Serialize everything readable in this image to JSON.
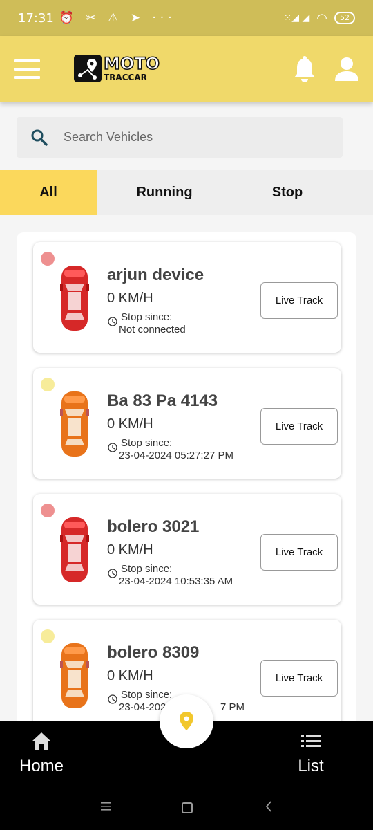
{
  "status_bar": {
    "time": "17:31",
    "icons": "⏰ ✂ ⚠ ➤ ···",
    "signal": "⁙◢ ◢",
    "battery": "52"
  },
  "app_bar": {
    "logo_title": "MOTO",
    "logo_subtitle": "TRACCAR",
    "accent_color": "#f0d96a"
  },
  "search": {
    "placeholder": "Search Vehicles"
  },
  "tabs": [
    {
      "label": "All",
      "active": true
    },
    {
      "label": "Running",
      "active": false
    },
    {
      "label": "Stop",
      "active": false
    }
  ],
  "vehicles": [
    {
      "name": "arjun device",
      "speed": "0 KM/H",
      "since_label": "Stop since:",
      "since_value": "Not connected",
      "status_color": "#ee9090",
      "car_color": "red",
      "button": "Live Track"
    },
    {
      "name": "Ba 83 Pa 4143",
      "speed": "0 KM/H",
      "since_label": "Stop since:",
      "since_value": "23-04-2024 05:27:27 PM",
      "status_color": "#f7ec9a",
      "car_color": "orange",
      "button": "Live Track"
    },
    {
      "name": "bolero 3021",
      "speed": "0 KM/H",
      "since_label": "Stop since:",
      "since_value": "23-04-2024 10:53:35 AM",
      "status_color": "#ee9090",
      "car_color": "red",
      "button": "Live Track"
    },
    {
      "name": "bolero 8309",
      "speed": "0 KM/H",
      "since_label": "Stop since:",
      "since_value": "23-04-202",
      "since_value_tail": "7 PM",
      "status_color": "#f7ec9a",
      "car_color": "orange",
      "button": "Live Track"
    }
  ],
  "bottom_nav": {
    "home_label": "Home",
    "list_label": "List"
  }
}
